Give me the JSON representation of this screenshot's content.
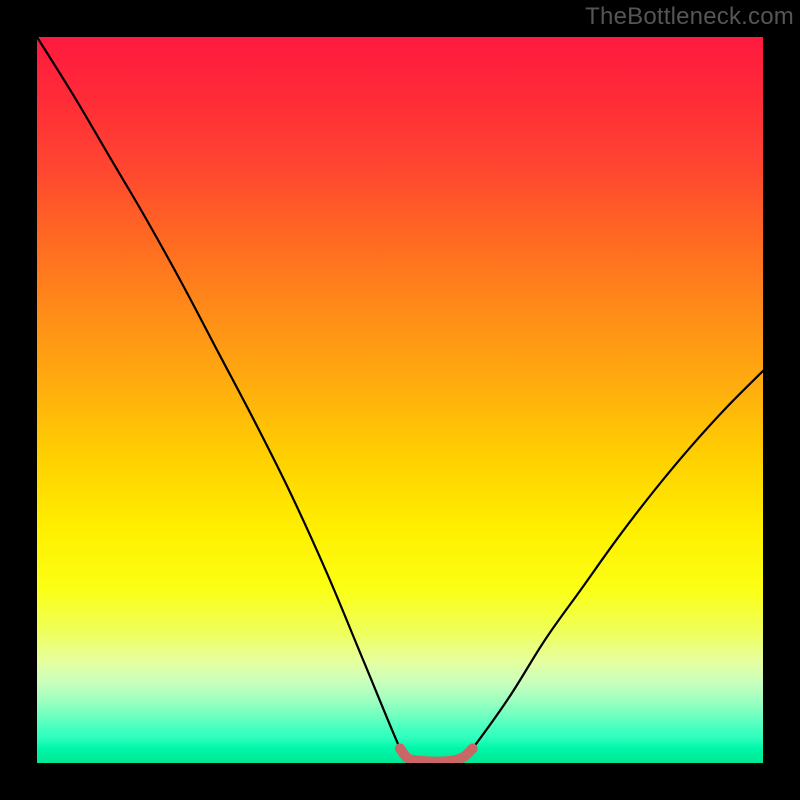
{
  "watermark": "TheBottleneck.com",
  "chart_data": {
    "type": "line",
    "title": "",
    "xlabel": "",
    "ylabel": "",
    "xlim": [
      0,
      100
    ],
    "ylim": [
      0,
      100
    ],
    "grid": false,
    "series": [
      {
        "name": "curve",
        "color": "#000000",
        "x": [
          0,
          5,
          10,
          15,
          20,
          25,
          30,
          35,
          40,
          45,
          50,
          51,
          52,
          53,
          54,
          55,
          56,
          57,
          58,
          59,
          60,
          65,
          70,
          75,
          80,
          85,
          90,
          95,
          100
        ],
        "values": [
          100,
          92,
          83.5,
          75,
          66,
          56.5,
          47,
          37,
          26,
          14,
          2,
          0.7,
          0.4,
          0.3,
          0.2,
          0.2,
          0.2,
          0.3,
          0.5,
          1.0,
          2,
          9,
          17,
          24,
          31,
          37.5,
          43.5,
          49,
          54
        ]
      },
      {
        "name": "bottom-highlight",
        "color": "#c96666",
        "x": [
          50,
          51,
          52,
          53,
          54,
          55,
          56,
          57,
          58,
          59,
          60
        ],
        "values": [
          2,
          0.7,
          0.4,
          0.3,
          0.2,
          0.2,
          0.2,
          0.3,
          0.5,
          1.0,
          2
        ]
      }
    ],
    "background_gradient": {
      "direction": "vertical",
      "stops": [
        {
          "pos": 0,
          "color": "#ff1a3f"
        },
        {
          "pos": 0.28,
          "color": "#ff6a22"
        },
        {
          "pos": 0.58,
          "color": "#ffd000"
        },
        {
          "pos": 0.82,
          "color": "#efff5c"
        },
        {
          "pos": 0.93,
          "color": "#6fffc0"
        },
        {
          "pos": 1.0,
          "color": "#00e793"
        }
      ]
    }
  }
}
